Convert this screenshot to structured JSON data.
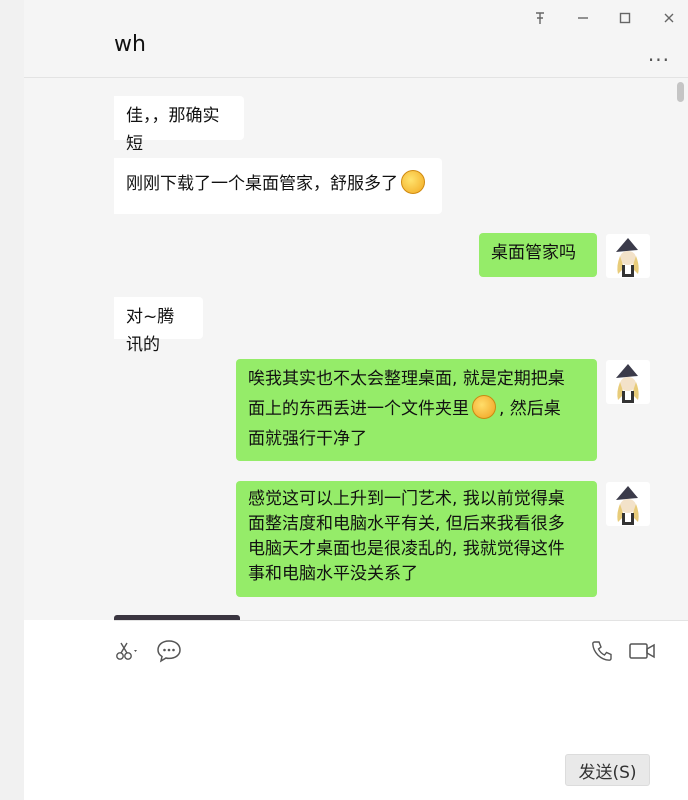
{
  "window": {
    "pin_icon": "pin-icon",
    "minimize_icon": "minimize-icon",
    "maximize_icon": "maximize-icon",
    "close_icon": "close-icon"
  },
  "chat": {
    "title": "wh",
    "more_label": "···"
  },
  "messages": [
    {
      "side": "in",
      "text": "佳，，那确实短"
    },
    {
      "side": "in",
      "text_before": "刚刚下载了一个桌面管家，舒服多了",
      "emoji": "grin-emoji"
    },
    {
      "side": "out",
      "text": "桌面管家吗"
    },
    {
      "side": "in",
      "text": "对~腾讯的"
    },
    {
      "side": "out",
      "line1": "唉我其实也不太会整理桌面, 就是定期把桌",
      "line2_before": "面上的东西丢进一个文件夹里",
      "emoji": "laugh-cry-emoji",
      "line2_after": ", 然后桌",
      "line3": "面就强行干净了"
    },
    {
      "side": "out",
      "lines": [
        "感觉这可以上升到一门艺术, 我以前觉得桌",
        "面整洁度和电脑水平有关, 但后来我看很多",
        "电脑天才桌面也是很凌乱的, 我就觉得这件",
        "事和电脑水平没关系了"
      ]
    }
  ],
  "composer": {
    "send_label": "发送(S)"
  }
}
